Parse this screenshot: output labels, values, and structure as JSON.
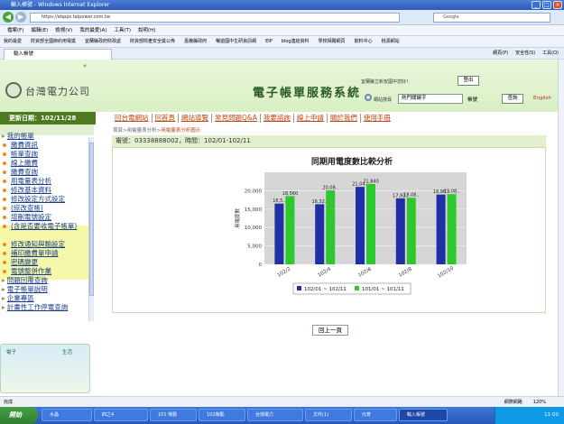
{
  "window": {
    "title": "輸入帳號 - Windows Internet Explorer"
  },
  "address": {
    "url": "https://ebpps.taipower.com.tw",
    "search_engine": "Google"
  },
  "menu": [
    "檔案(F)",
    "編輯(E)",
    "檢視(V)",
    "我的最愛(A)",
    "工具(T)",
    "說明(H)"
  ],
  "favorites": [
    "我的最愛",
    "財資部全國節約用電獎",
    "宜蘭縣政府財政處",
    "財資部財產安全獎公佈",
    "嘉義縣政府",
    "暢遊國中生研資訊網",
    "EIP",
    "blog連結資料",
    "學校相關網頁",
    "飲料中心",
    "桃源網站"
  ],
  "tab": {
    "label": "輸入帳號"
  },
  "tools": [
    "網頁(P)",
    "安全性(S)",
    "工具(O)"
  ],
  "banner": {
    "logo": "台灣電力公司",
    "title": "電子帳單服務系統",
    "welcome": "宜蘭縣立新安國中您好！",
    "logout": "登出",
    "search_label": "網站搜尋",
    "keyword_placeholder": "熱門關鍵字",
    "kw_label": "帳號",
    "query": "查詢",
    "english": "English"
  },
  "update_date": "更新日期：102/11/28",
  "topnav": [
    "回台電網站",
    "回首頁",
    "網站導覽",
    "常見問題Q&A",
    "我要諮詢",
    "線上申請",
    "關於我們",
    "使用手冊"
  ],
  "sidebar": [
    {
      "label": "我的帳單",
      "main": true
    },
    {
      "label": "繳費資訊"
    },
    {
      "label": "帳單查詢"
    },
    {
      "label": "線上繳費"
    },
    {
      "label": "繳費查詢"
    },
    {
      "label": "用電量表分析"
    },
    {
      "label": "修改基本資料"
    },
    {
      "label": "修改設定方式設定"
    },
    {
      "label": "(綜改查帳)"
    },
    {
      "label": "增刪電號設定"
    },
    {
      "label": "(含是否要收電子帳單)"
    },
    {
      "label": "修改通知與輸設定"
    },
    {
      "label": "補印繳費單申請"
    },
    {
      "label": "密碼變更"
    },
    {
      "label": "電號整併作業"
    },
    {
      "label": "問題回覆查詢",
      "main": true
    },
    {
      "label": "電子帳單說明",
      "main": true
    },
    {
      "label": "企業專區",
      "main": true
    },
    {
      "label": "計畫性工作停電查詢",
      "main": true
    }
  ],
  "illust": {
    "t1": "電子",
    "t2": "生活"
  },
  "breadcrumb": {
    "path": "首頁>用電量表分析>",
    "current": "用電量表分析圖示"
  },
  "info": "電號：03338888002，時間：102/01-102/11",
  "chart_data": {
    "type": "bar",
    "title": "同期用電度數比較分析",
    "xlabel": "日期區間",
    "ylabel": "用電度數",
    "categories": [
      "102/2",
      "102/4",
      "102/6",
      "102/8",
      "102/10"
    ],
    "series": [
      {
        "name": "102/01 ~ 102/11",
        "color": "#1f2fa6",
        "values": [
          16500,
          16320,
          21040,
          17920,
          18960
        ]
      },
      {
        "name": "101/01 ~ 101/11",
        "color": "#2ec82e",
        "values": [
          18560,
          20080,
          21840,
          18080,
          19080
        ]
      }
    ],
    "data_labels": [
      "16,5..",
      "18,560",
      "16,32..",
      "20,08..",
      "21,04..",
      "21,840",
      "17,92..",
      "18,08..",
      "18,96..",
      "19,08.."
    ],
    "yticks": [
      "0",
      "5,000",
      "10,000",
      "15,000",
      "20,000"
    ],
    "ylim": [
      0,
      25000
    ],
    "legend_position": "bottom"
  },
  "back_button": "回上一頁",
  "status": {
    "left": "完成",
    "zone": "網際網路",
    "zoom": "120%"
  },
  "taskbar": {
    "start": "開始",
    "tasks": [
      "水晶",
      "四之4",
      "101 傑勤",
      "102傑勤",
      "台灣電力",
      "文件(1)",
      "元育",
      "輸入帳號"
    ],
    "time": "11:00"
  }
}
